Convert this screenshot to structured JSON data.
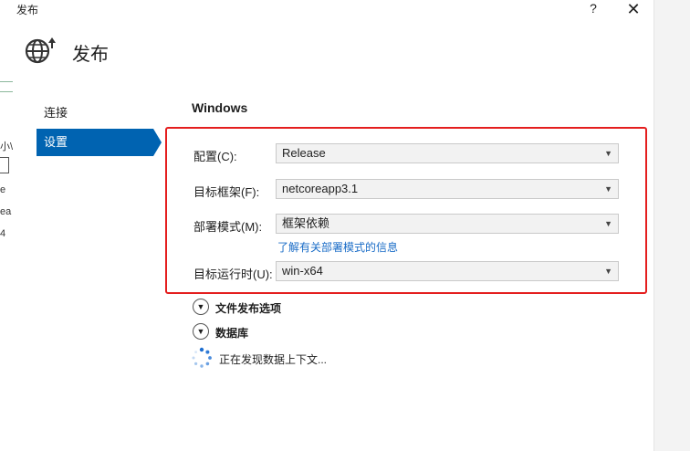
{
  "window": {
    "title": "发布",
    "help": "?",
    "close": "✕"
  },
  "background_window": {
    "fragments": [
      "小\\",
      "e",
      "ea",
      "4"
    ]
  },
  "header": {
    "title": "发布"
  },
  "sidebar": {
    "items": [
      {
        "label": "连接"
      },
      {
        "label": "设置"
      }
    ]
  },
  "section": {
    "title": "Windows"
  },
  "form": {
    "configuration": {
      "label": "配置(C):",
      "value": "Release"
    },
    "target_framework": {
      "label": "目标框架(F):",
      "value": "netcoreapp3.1"
    },
    "deployment_mode": {
      "label": "部署模式(M):",
      "value": "框架依赖",
      "link": "了解有关部署模式的信息"
    },
    "target_runtime": {
      "label": "目标运行时(U):",
      "value": "win-x64"
    }
  },
  "expanders": [
    {
      "label": "文件发布选项"
    },
    {
      "label": "数据库"
    }
  ],
  "status": {
    "loading_text": "正在发现数据上下文..."
  },
  "colors": {
    "accent": "#0063b1",
    "highlight": "#e41e1e",
    "link": "#1a6cc7"
  }
}
